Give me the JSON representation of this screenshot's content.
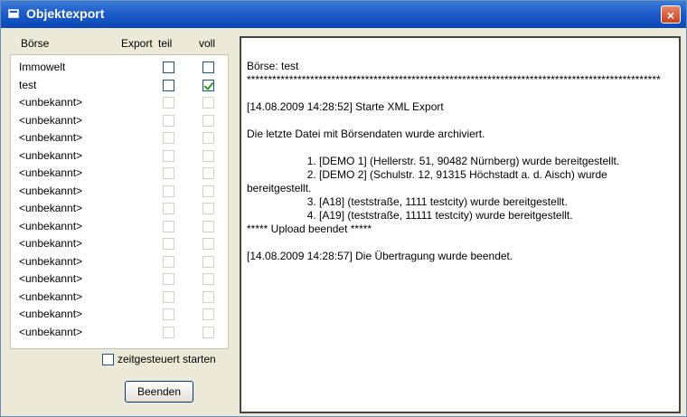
{
  "window": {
    "title": "Objektexport",
    "close_glyph": "×",
    "icon": "window-app-icon",
    "title_color": "#1e5cc8"
  },
  "table": {
    "headers": {
      "boerse": "Börse",
      "export": "Export",
      "teil": "teil",
      "voll": "voll"
    },
    "rows": [
      {
        "name": "Immowelt",
        "enabled": true,
        "teil": false,
        "voll": false
      },
      {
        "name": "test",
        "enabled": true,
        "teil": false,
        "voll": true
      },
      {
        "name": "<unbekannt>",
        "enabled": false,
        "teil": false,
        "voll": false
      },
      {
        "name": "<unbekannt>",
        "enabled": false,
        "teil": false,
        "voll": false
      },
      {
        "name": "<unbekannt>",
        "enabled": false,
        "teil": false,
        "voll": false
      },
      {
        "name": "<unbekannt>",
        "enabled": false,
        "teil": false,
        "voll": false
      },
      {
        "name": "<unbekannt>",
        "enabled": false,
        "teil": false,
        "voll": false
      },
      {
        "name": "<unbekannt>",
        "enabled": false,
        "teil": false,
        "voll": false
      },
      {
        "name": "<unbekannt>",
        "enabled": false,
        "teil": false,
        "voll": false
      },
      {
        "name": "<unbekannt>",
        "enabled": false,
        "teil": false,
        "voll": false
      },
      {
        "name": "<unbekannt>",
        "enabled": false,
        "teil": false,
        "voll": false
      },
      {
        "name": "<unbekannt>",
        "enabled": false,
        "teil": false,
        "voll": false
      },
      {
        "name": "<unbekannt>",
        "enabled": false,
        "teil": false,
        "voll": false
      },
      {
        "name": "<unbekannt>",
        "enabled": false,
        "teil": false,
        "voll": false
      },
      {
        "name": "<unbekannt>",
        "enabled": false,
        "teil": false,
        "voll": false
      },
      {
        "name": "<unbekannt>",
        "enabled": false,
        "teil": false,
        "voll": false
      }
    ]
  },
  "timer": {
    "label": "zeitgesteuert starten",
    "checked": false
  },
  "button": {
    "label": "Beenden"
  },
  "log": {
    "lines": [
      "Börse: test",
      "**************************************************************************************************",
      "",
      "[14.08.2009 14:28:52] Starte XML Export",
      "",
      "Die letzte Datei mit Börsendaten wurde archiviert.",
      "",
      "                    1. [DEMO 1] (Hellerstr. 51, 90482 Nürnberg) wurde bereitgestellt.",
      "                    2. [DEMO 2] (Schulstr. 12, 91315 Höchstadt a. d. Aisch) wurde bereitgestellt.",
      "                    3. [A18] (teststraße, 1111 testcity) wurde bereitgestellt.",
      "                    4. [A19] (teststraße, 11111 testcity) wurde bereitgestellt.",
      "***** Upload beendet *****",
      "",
      "[14.08.2009 14:28:57] Die Übertragung wurde beendet."
    ]
  }
}
